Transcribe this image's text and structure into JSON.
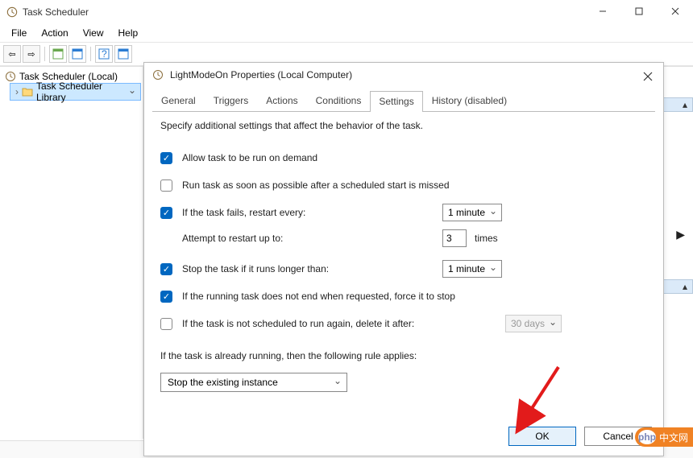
{
  "window": {
    "title": "Task Scheduler",
    "menu": {
      "file": "File",
      "action": "Action",
      "view": "View",
      "help": "Help"
    }
  },
  "tree": {
    "root": "Task Scheduler (Local)",
    "child": "Task Scheduler Library"
  },
  "dialog": {
    "title": "LightModeOn Properties (Local Computer)",
    "tabs": {
      "general": "General",
      "triggers": "Triggers",
      "actions": "Actions",
      "conditions": "Conditions",
      "settings": "Settings",
      "history": "History (disabled)"
    },
    "desc": "Specify additional settings that affect the behavior of the task.",
    "settings": {
      "allow_demand": "Allow task to be run on demand",
      "run_missed": "Run task as soon as possible after a scheduled start is missed",
      "restart_every": "If the task fails, restart every:",
      "restart_every_value": "1 minute",
      "attempt_label": "Attempt to restart up to:",
      "attempt_value": "3",
      "attempt_suffix": "times",
      "stop_longer": "Stop the task if it runs longer than:",
      "stop_longer_value": "1 minute",
      "force_stop": "If the running task does not end when requested, force it to stop",
      "delete_after": "If the task is not scheduled to run again, delete it after:",
      "delete_after_value": "30 days",
      "running_rule": "If the task is already running, then the following rule applies:",
      "rule_value": "Stop the existing instance"
    },
    "buttons": {
      "ok": "OK",
      "cancel": "Cancel"
    }
  },
  "badge": {
    "php": "php",
    "text": "中文网"
  }
}
